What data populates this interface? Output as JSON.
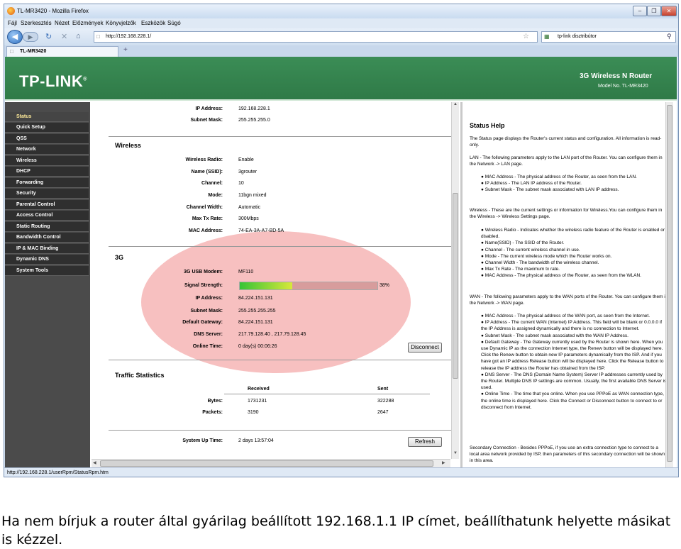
{
  "browser": {
    "window_title": "TL-MR3420 - Mozilla Firefox",
    "menu": [
      "Fájl",
      "Szerkesztés",
      "Nézet",
      "Előzmények",
      "Könyvjelzők",
      "Eszközök",
      "Súgó"
    ],
    "url": "http://192.168.228.1/",
    "search_placeholder": "tp-link disztribútor",
    "tab_title": "TL-MR3420",
    "tab_add": "+",
    "status_url": "http://192.168.228.1/userRpm/StatusRpm.htm"
  },
  "header": {
    "logo": "TP-LINK",
    "logo_mark": "®",
    "product": "3G Wireless N Router",
    "model": "Model No. TL-MR3420"
  },
  "sidebar": {
    "items": [
      {
        "label": "Status"
      },
      {
        "label": "Quick Setup"
      },
      {
        "label": "QSS"
      },
      {
        "label": "Network"
      },
      {
        "label": "Wireless"
      },
      {
        "label": "DHCP"
      },
      {
        "label": "Forwarding"
      },
      {
        "label": "Security"
      },
      {
        "label": "Parental Control"
      },
      {
        "label": "Access Control"
      },
      {
        "label": "Static Routing"
      },
      {
        "label": "Bandwidth Control"
      },
      {
        "label": "IP & MAC Binding"
      },
      {
        "label": "Dynamic DNS"
      },
      {
        "label": "System Tools"
      }
    ]
  },
  "lan": {
    "ip_label": "IP Address:",
    "ip": "192.168.228.1",
    "mask_label": "Subnet Mask:",
    "mask": "255.255.255.0"
  },
  "wireless": {
    "heading": "Wireless",
    "rows": [
      {
        "label": "Wireless Radio:",
        "value": "Enable"
      },
      {
        "label": "Name (SSID):",
        "value": "3grouter"
      },
      {
        "label": "Channel:",
        "value": "10"
      },
      {
        "label": "Mode:",
        "value": "11bgn mixed"
      },
      {
        "label": "Channel Width:",
        "value": "Automatic"
      },
      {
        "label": "Max Tx Rate:",
        "value": "300Mbps"
      },
      {
        "label": "MAC Address:",
        "value": "74-EA-3A-A7-BD-5A"
      }
    ]
  },
  "g3": {
    "heading": "3G",
    "modem_label": "3G USB Modem:",
    "modem": "MF110",
    "signal_label": "Signal Strength:",
    "signal_text": "38%",
    "signal_fraction": 0.38,
    "rows": [
      {
        "label": "IP Address:",
        "value": "84.224.151.131"
      },
      {
        "label": "Subnet Mask:",
        "value": "255.255.255.255"
      },
      {
        "label": "Default Gateway:",
        "value": "84.224.151.131"
      },
      {
        "label": "DNS Server:",
        "value": "217.79.128.40 , 217.79.128.45"
      },
      {
        "label": "Online Time:",
        "value": "0 day(s) 00:06:26"
      }
    ],
    "disconnect": "Disconnect"
  },
  "traffic": {
    "heading": "Traffic Statistics",
    "col_received": "Received",
    "col_sent": "Sent",
    "bytes_label": "Bytes:",
    "bytes_received": "1731231",
    "bytes_sent": "322288",
    "packets_label": "Packets:",
    "packets_received": "3190",
    "packets_sent": "2647"
  },
  "uptime": {
    "label": "System Up Time:",
    "value": "2 days 13:57:04",
    "refresh": "Refresh"
  },
  "help": {
    "title": "Status Help",
    "intro": "The Status page displays the Router's current status and configuration. All information is read-only.",
    "lan_intro": "LAN - The following parameters apply to the LAN port of the Router. You can configure them in the Network -> LAN page.",
    "lan_items": [
      "MAC Address - The physical address of the Router, as seen from the LAN.",
      "IP Address - The LAN IP address of the Router.",
      "Subnet Mask - The subnet mask associated with LAN IP address."
    ],
    "wl_intro": "Wireless - These are the current settings or information for Wireless.You can configure them in the Wireless -> Wireless Settings page.",
    "wl_items": [
      "Wireless Radio - Indicates whether the wireless radio feature of the Router is enabled or disabled.",
      "Name(SSID) - The SSID of the Router.",
      "Channel - The current wireless channel in use.",
      "Mode - The current wireless mode which the Router works on.",
      "Channel Width - The bandwidth of the wireless channel.",
      "Max Tx Rate - The maximum tx rate.",
      "MAC Address - The physical address of the Router, as seen from the WLAN."
    ],
    "wan_intro": "WAN - The following parameters apply to the WAN ports of the Router. You can configure them in the Network -> WAN page.",
    "wan_items": [
      "MAC Address - The physical address of the WAN port, as seen from the Internet.",
      "IP Address - The current WAN (Internet) IP Address. This field will be blank or 0.0.0.0 if the IP Address is assigned dynamically and there is no connection to Internet.",
      "Subnet Mask - The subnet mask associated with the WAN IP Address.",
      "Default Gateway - The Gateway currently used by the Router is shown here. When you use Dynamic IP as the connection Internet type, the Renew button will be displayed here. Click the Renew button to obtain new IP parameters dynamically from the ISP. And if you have got an IP address Release button will be displayed here. Click the Release button to release the IP address the Router has obtained from the ISP.",
      "DNS Server - The DNS (Domain Name System) Server IP addresses currently used by the Router. Multiple DNS IP settings are common. Usually, the first available DNS Server is used.",
      "Online Time - The time that you online. When you use PPPoE as WAN connection type, the online time is displayed here. Click the Connect or Disconnect button to connect to or disconnect from Internet."
    ],
    "secondary": "Secondary Connection - Besides PPPoE, if you use an extra connection type to connect to a local area network provided by ISP, then parameters of this secondary connection will be shown in this area."
  },
  "caption": "Ha nem bírjuk a router által gyárilag beállított 192.168.1.1 IP címet, beállíthatunk helyette másikat is kézzel."
}
